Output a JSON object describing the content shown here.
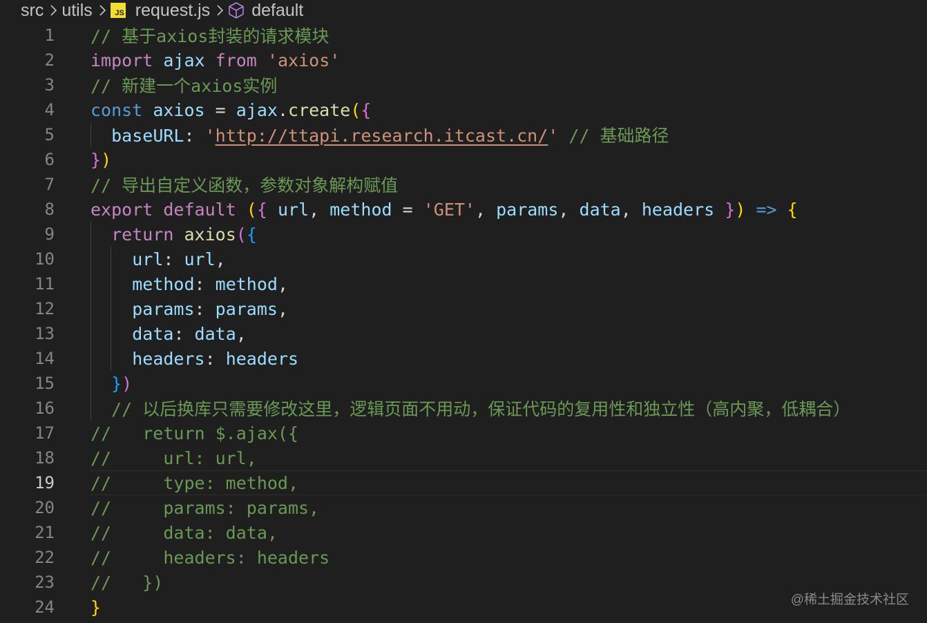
{
  "breadcrumb": {
    "folder1": "src",
    "folder2": "utils",
    "file_icon": "JS",
    "file": "request.js",
    "symbol": "default"
  },
  "colors": {
    "background": "#1f1f1f",
    "keyword": "#c586c0",
    "storage": "#569cd6",
    "variable": "#9cdcfe",
    "function": "#dcdcaa",
    "string": "#ce9178",
    "comment": "#6a9955",
    "bracket_gold": "#ffd700",
    "bracket_purple": "#da70d6",
    "bracket_blue": "#179fff"
  },
  "editor": {
    "current_line": 19,
    "line_numbers": [
      "1",
      "2",
      "3",
      "4",
      "5",
      "6",
      "7",
      "8",
      "9",
      "10",
      "11",
      "12",
      "13",
      "14",
      "15",
      "16",
      "17",
      "18",
      "19",
      "20",
      "21",
      "22",
      "23",
      "24"
    ],
    "lines": [
      [
        {
          "t": "// 基于axios封装的请求模块",
          "c": "cm"
        }
      ],
      [
        {
          "t": "import",
          "c": "kw"
        },
        {
          "t": " ",
          "c": "pu"
        },
        {
          "t": "ajax",
          "c": "id"
        },
        {
          "t": " ",
          "c": "pu"
        },
        {
          "t": "from",
          "c": "kw"
        },
        {
          "t": " ",
          "c": "pu"
        },
        {
          "t": "'axios'",
          "c": "st"
        }
      ],
      [
        {
          "t": "// 新建一个axios实例",
          "c": "cm"
        }
      ],
      [
        {
          "t": "const",
          "c": "kb"
        },
        {
          "t": " ",
          "c": "pu"
        },
        {
          "t": "axios",
          "c": "id"
        },
        {
          "t": " = ",
          "c": "pu"
        },
        {
          "t": "ajax",
          "c": "id"
        },
        {
          "t": ".",
          "c": "pu"
        },
        {
          "t": "create",
          "c": "fn"
        },
        {
          "t": "(",
          "c": "b1"
        },
        {
          "t": "{",
          "c": "b2"
        }
      ],
      [
        {
          "t": "  ",
          "c": "pu"
        },
        {
          "t": "baseURL",
          "c": "id"
        },
        {
          "t": ": ",
          "c": "pu"
        },
        {
          "t": "'",
          "c": "st"
        },
        {
          "t": "http://ttapi.research.itcast.cn/",
          "c": "st url"
        },
        {
          "t": "'",
          "c": "st"
        },
        {
          "t": " ",
          "c": "pu"
        },
        {
          "t": "// 基础路径",
          "c": "cm"
        }
      ],
      [
        {
          "t": "}",
          "c": "b2"
        },
        {
          "t": ")",
          "c": "b1"
        }
      ],
      [
        {
          "t": "// 导出自定义函数，参数对象解构赋值",
          "c": "cm"
        }
      ],
      [
        {
          "t": "export",
          "c": "kw"
        },
        {
          "t": " ",
          "c": "pu"
        },
        {
          "t": "default",
          "c": "kw"
        },
        {
          "t": " ",
          "c": "pu"
        },
        {
          "t": "(",
          "c": "b1"
        },
        {
          "t": "{",
          "c": "b2"
        },
        {
          "t": " ",
          "c": "pu"
        },
        {
          "t": "url",
          "c": "id"
        },
        {
          "t": ", ",
          "c": "pu"
        },
        {
          "t": "method",
          "c": "id"
        },
        {
          "t": " = ",
          "c": "pu"
        },
        {
          "t": "'GET'",
          "c": "st"
        },
        {
          "t": ", ",
          "c": "pu"
        },
        {
          "t": "params",
          "c": "id"
        },
        {
          "t": ", ",
          "c": "pu"
        },
        {
          "t": "data",
          "c": "id"
        },
        {
          "t": ", ",
          "c": "pu"
        },
        {
          "t": "headers",
          "c": "id"
        },
        {
          "t": " ",
          "c": "pu"
        },
        {
          "t": "}",
          "c": "b2"
        },
        {
          "t": ")",
          "c": "b1"
        },
        {
          "t": " ",
          "c": "pu"
        },
        {
          "t": "=>",
          "c": "kb"
        },
        {
          "t": " ",
          "c": "pu"
        },
        {
          "t": "{",
          "c": "b1"
        }
      ],
      [
        {
          "t": "  ",
          "c": "pu"
        },
        {
          "t": "return",
          "c": "kw"
        },
        {
          "t": " ",
          "c": "pu"
        },
        {
          "t": "axios",
          "c": "fn"
        },
        {
          "t": "(",
          "c": "b2"
        },
        {
          "t": "{",
          "c": "b3"
        }
      ],
      [
        {
          "t": "    ",
          "c": "pu"
        },
        {
          "t": "url",
          "c": "id"
        },
        {
          "t": ": ",
          "c": "pu"
        },
        {
          "t": "url",
          "c": "id"
        },
        {
          "t": ",",
          "c": "pu"
        }
      ],
      [
        {
          "t": "    ",
          "c": "pu"
        },
        {
          "t": "method",
          "c": "id"
        },
        {
          "t": ": ",
          "c": "pu"
        },
        {
          "t": "method",
          "c": "id"
        },
        {
          "t": ",",
          "c": "pu"
        }
      ],
      [
        {
          "t": "    ",
          "c": "pu"
        },
        {
          "t": "params",
          "c": "id"
        },
        {
          "t": ": ",
          "c": "pu"
        },
        {
          "t": "params",
          "c": "id"
        },
        {
          "t": ",",
          "c": "pu"
        }
      ],
      [
        {
          "t": "    ",
          "c": "pu"
        },
        {
          "t": "data",
          "c": "id"
        },
        {
          "t": ": ",
          "c": "pu"
        },
        {
          "t": "data",
          "c": "id"
        },
        {
          "t": ",",
          "c": "pu"
        }
      ],
      [
        {
          "t": "    ",
          "c": "pu"
        },
        {
          "t": "headers",
          "c": "id"
        },
        {
          "t": ": ",
          "c": "pu"
        },
        {
          "t": "headers",
          "c": "id"
        }
      ],
      [
        {
          "t": "  ",
          "c": "pu"
        },
        {
          "t": "}",
          "c": "b3"
        },
        {
          "t": ")",
          "c": "b2"
        }
      ],
      [
        {
          "t": "  ",
          "c": "pu"
        },
        {
          "t": "// 以后换库只需要修改这里，逻辑页面不用动，保证代码的复用性和独立性（高内聚，低耦合）",
          "c": "cm"
        }
      ],
      [
        {
          "t": "//   return $.ajax({",
          "c": "cm"
        }
      ],
      [
        {
          "t": "//     url: url,",
          "c": "cm"
        }
      ],
      [
        {
          "t": "//     type: method,",
          "c": "cm"
        }
      ],
      [
        {
          "t": "//     params: params,",
          "c": "cm"
        }
      ],
      [
        {
          "t": "//     data: data,",
          "c": "cm"
        }
      ],
      [
        {
          "t": "//     headers: headers",
          "c": "cm"
        }
      ],
      [
        {
          "t": "//   })",
          "c": "cm"
        }
      ],
      [
        {
          "t": "}",
          "c": "b1"
        }
      ]
    ]
  },
  "watermark": "@稀土掘金技术社区"
}
